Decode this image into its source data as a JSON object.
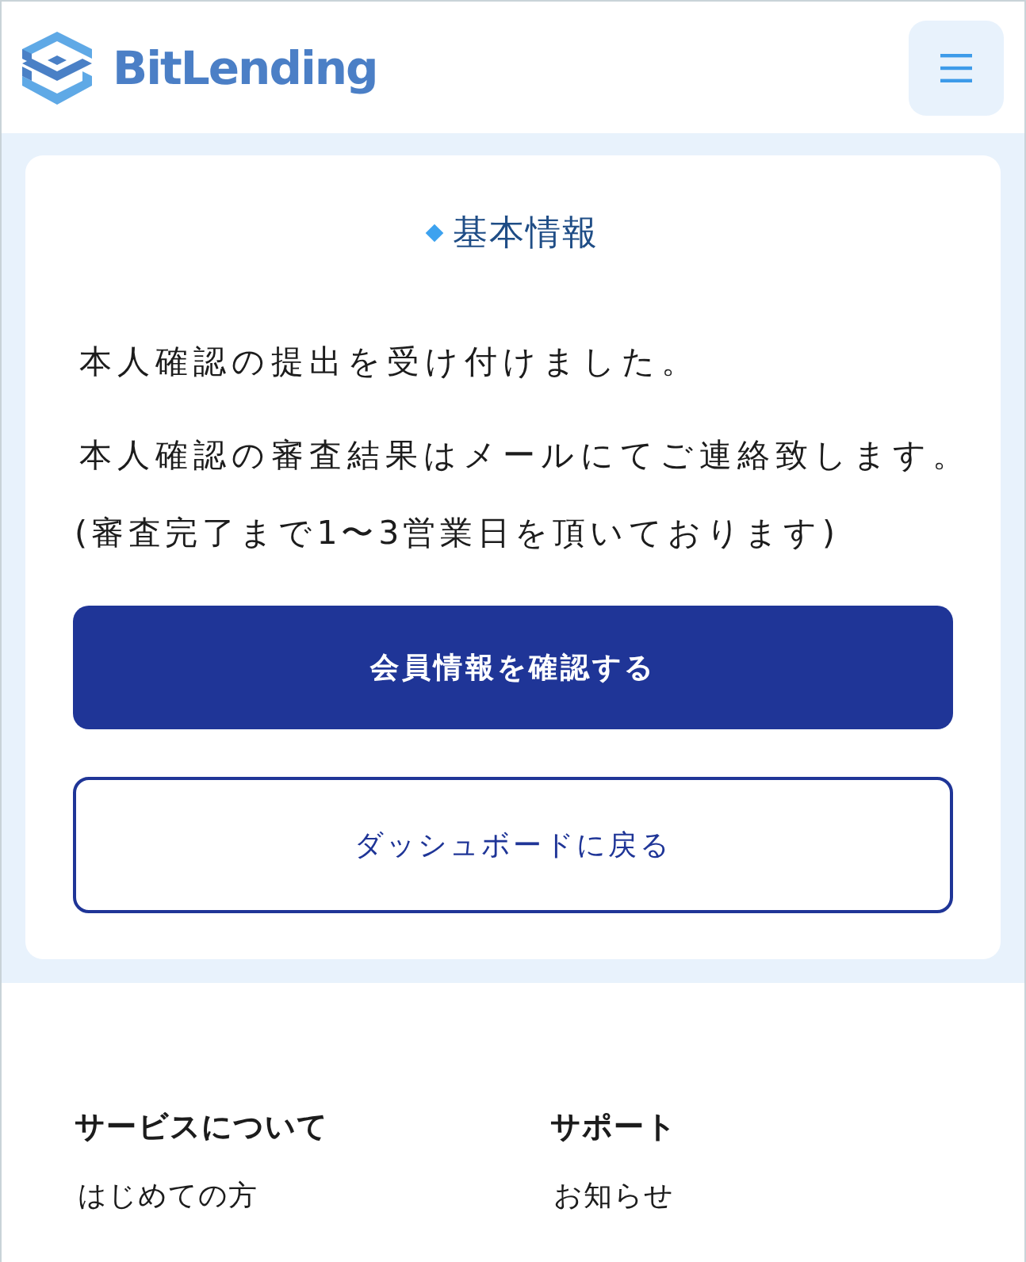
{
  "header": {
    "logo": "BitLending"
  },
  "card": {
    "title": "基本情報",
    "messages": [
      "本人確認の提出を受け付けました。",
      "本人確認の審査結果はメールにてご連絡致します。",
      "(審査完了まで1〜3営業日を頂いております)"
    ],
    "buttons": [
      {
        "label": "会員情報を確認する",
        "kind": "primary"
      },
      {
        "label": "ダッシュボードに戻る",
        "kind": "secondary"
      }
    ]
  },
  "footer": {
    "columns": [
      {
        "heading": "サービスについて",
        "links": [
          "はじめての方"
        ]
      },
      {
        "heading": "サポート",
        "links": [
          "お知らせ"
        ]
      }
    ]
  }
}
